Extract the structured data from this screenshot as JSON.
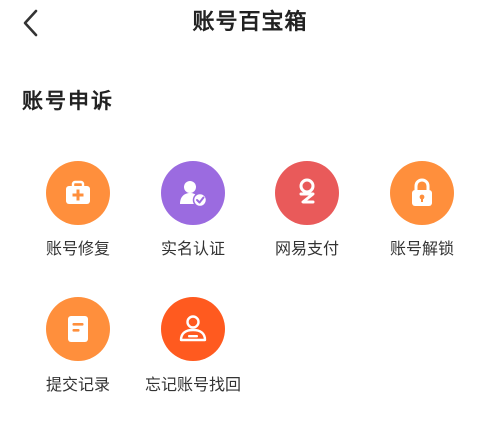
{
  "header": {
    "title": "账号百宝箱",
    "back_icon": "chevron-left-icon"
  },
  "section": {
    "title": "账号申诉"
  },
  "items": [
    {
      "label": "账号修复",
      "icon": "first-aid-kit-icon",
      "color": "#FF8F3C"
    },
    {
      "label": "实名认证",
      "icon": "verified-user-icon",
      "color": "#9B6BE0"
    },
    {
      "label": "网易支付",
      "icon": "netease-pay-icon",
      "color": "#E95A5A"
    },
    {
      "label": "账号解锁",
      "icon": "lock-icon",
      "color": "#FF8F3C"
    },
    {
      "label": "提交记录",
      "icon": "document-icon",
      "color": "#FF8F3C"
    },
    {
      "label": "忘记账号找回",
      "icon": "id-card-icon",
      "color": "#FF5A1F"
    }
  ]
}
